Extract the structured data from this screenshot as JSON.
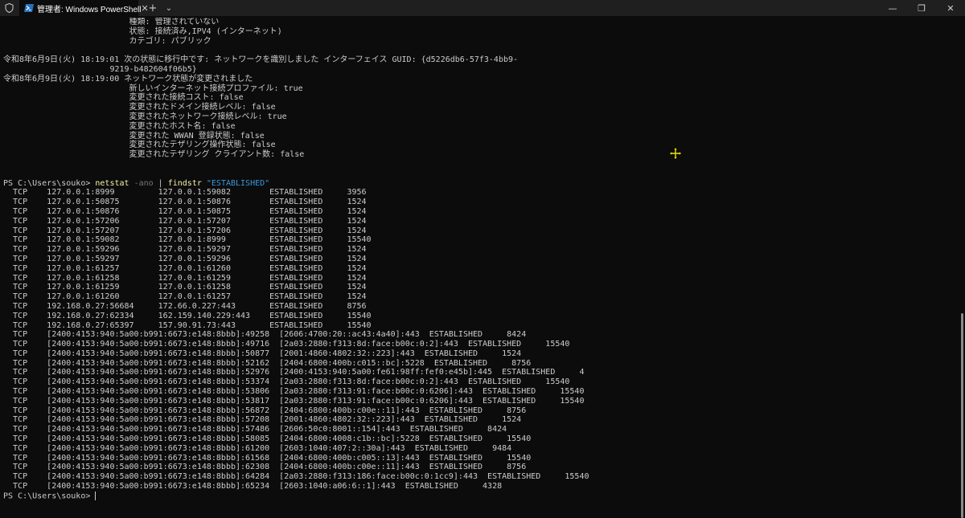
{
  "window": {
    "tab_title": "管理者: Windows PowerShell",
    "tab_close": "✕",
    "new_tab": "+",
    "dropdown": "⌄",
    "minimize": "—",
    "maximize": "❐",
    "close": "✕"
  },
  "colors": {
    "background": "#0c0c0c",
    "text": "#cccccc",
    "command": "#f9f1a5",
    "flag": "#767676",
    "string": "#3a96dd"
  },
  "icons": [
    "shield-icon",
    "powershell-icon",
    "move-cursor-icon"
  ],
  "log_lines": [
    "                          種類: 管理されていない",
    "                          状態: 接続済み,IPV4 (インターネット)",
    "                          カテゴリ: パブリック",
    "",
    "令和8年6月9日(火) 18:19:01 次の状態に移行中です: ネットワークを識別しました インターフェイス GUID: {d5226db6-57f3-4bb9-",
    "                      9219-b482604f06b5}",
    "令和8年6月9日(火) 18:19:00 ネットワーク状態が変更されました",
    "                          新しいインターネット接続プロファイル: true",
    "                          変更された接続コスト: false",
    "                          変更されたドメイン接続レベル: false",
    "                          変更されたネットワーク接続レベル: true",
    "                          変更されたホスト名: false",
    "                          変更された WWAN 登録状態: false",
    "                          変更されたテザリング操作状態: false",
    "                          変更されたテザリング クライアント数: false",
    "",
    ""
  ],
  "command": {
    "prompt": "PS C:\\Users\\souko> ",
    "cmd": "netstat",
    "flag": " -ano",
    "pipe": " | ",
    "cmd2": "findstr",
    "arg": " \"ESTABLISHED\""
  },
  "rows": [
    "  TCP    127.0.0.1:8999         127.0.0.1:59082        ESTABLISHED     3956",
    "  TCP    127.0.0.1:50875        127.0.0.1:50876        ESTABLISHED     1524",
    "  TCP    127.0.0.1:50876        127.0.0.1:50875        ESTABLISHED     1524",
    "  TCP    127.0.0.1:57206        127.0.0.1:57207        ESTABLISHED     1524",
    "  TCP    127.0.0.1:57207        127.0.0.1:57206        ESTABLISHED     1524",
    "  TCP    127.0.0.1:59082        127.0.0.1:8999         ESTABLISHED     15540",
    "  TCP    127.0.0.1:59296        127.0.0.1:59297        ESTABLISHED     1524",
    "  TCP    127.0.0.1:59297        127.0.0.1:59296        ESTABLISHED     1524",
    "  TCP    127.0.0.1:61257        127.0.0.1:61260        ESTABLISHED     1524",
    "  TCP    127.0.0.1:61258        127.0.0.1:61259        ESTABLISHED     1524",
    "  TCP    127.0.0.1:61259        127.0.0.1:61258        ESTABLISHED     1524",
    "  TCP    127.0.0.1:61260        127.0.0.1:61257        ESTABLISHED     1524",
    "  TCP    192.168.0.27:56684     172.66.0.227:443       ESTABLISHED     8756",
    "  TCP    192.168.0.27:62334     162.159.140.229:443    ESTABLISHED     15540",
    "  TCP    192.168.0.27:65397     157.90.91.73:443       ESTABLISHED     15540",
    "  TCP    [2400:4153:940:5a00:b991:6673:e148:8bbb]:49258  [2606:4700:20::ac43:4a40]:443  ESTABLISHED     8424",
    "  TCP    [2400:4153:940:5a00:b991:6673:e148:8bbb]:49716  [2a03:2880:f313:8d:face:b00c:0:2]:443  ESTABLISHED     15540",
    "  TCP    [2400:4153:940:5a00:b991:6673:e148:8bbb]:50877  [2001:4860:4802:32::223]:443  ESTABLISHED     1524",
    "  TCP    [2400:4153:940:5a00:b991:6673:e148:8bbb]:52162  [2404:6800:400b:c015::bc]:5228  ESTABLISHED     8756",
    "  TCP    [2400:4153:940:5a00:b991:6673:e148:8bbb]:52976  [2400:4153:940:5a00:fe61:98ff:fef0:e45b]:445  ESTABLISHED     4",
    "  TCP    [2400:4153:940:5a00:b991:6673:e148:8bbb]:53374  [2a03:2880:f313:8d:face:b00c:0:2]:443  ESTABLISHED     15540",
    "  TCP    [2400:4153:940:5a00:b991:6673:e148:8bbb]:53806  [2a03:2880:f313:91:face:b00c:0:6206]:443  ESTABLISHED     15540",
    "  TCP    [2400:4153:940:5a00:b991:6673:e148:8bbb]:53817  [2a03:2880:f313:91:face:b00c:0:6206]:443  ESTABLISHED     15540",
    "  TCP    [2400:4153:940:5a00:b991:6673:e148:8bbb]:56872  [2404:6800:400b:c00e::11]:443  ESTABLISHED     8756",
    "  TCP    [2400:4153:940:5a00:b991:6673:e148:8bbb]:57208  [2001:4860:4802:32::223]:443  ESTABLISHED     1524",
    "  TCP    [2400:4153:940:5a00:b991:6673:e148:8bbb]:57486  [2606:50c0:8001::154]:443  ESTABLISHED     8424",
    "  TCP    [2400:4153:940:5a00:b991:6673:e148:8bbb]:58085  [2404:6800:4008:c1b::bc]:5228  ESTABLISHED     15540",
    "  TCP    [2400:4153:940:5a00:b991:6673:e148:8bbb]:61200  [2603:1040:407:2::30a]:443  ESTABLISHED     9484",
    "  TCP    [2400:4153:940:5a00:b991:6673:e148:8bbb]:61568  [2404:6800:400b:c005::13]:443  ESTABLISHED     15540",
    "  TCP    [2400:4153:940:5a00:b991:6673:e148:8bbb]:62308  [2404:6800:400b:c00e::11]:443  ESTABLISHED     8756",
    "  TCP    [2400:4153:940:5a00:b991:6673:e148:8bbb]:64284  [2a03:2880:f313:186:face:b00c:0:1cc9]:443  ESTABLISHED     15540",
    "  TCP    [2400:4153:940:5a00:b991:6673:e148:8bbb]:65234  [2603:1040:a06:6::1]:443  ESTABLISHED     4328"
  ],
  "final_prompt": "PS C:\\Users\\souko> "
}
